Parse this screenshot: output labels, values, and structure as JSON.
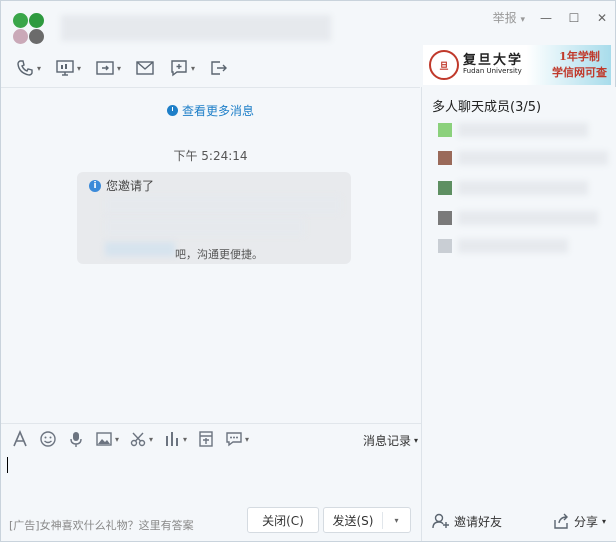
{
  "titlebar": {
    "report_label": "举报",
    "report_caret": "▾",
    "minimize": "—",
    "maximize": "☐",
    "close": "✕"
  },
  "toolbar": {
    "items": [
      {
        "name": "phone-icon"
      },
      {
        "name": "screen-share-icon"
      },
      {
        "name": "file-transfer-icon"
      },
      {
        "name": "mail-icon"
      },
      {
        "name": "add-app-icon"
      },
      {
        "name": "exit-group-icon"
      }
    ]
  },
  "banner": {
    "emblem": "旦",
    "univ_cn": "复旦大学",
    "univ_en": "Fudan University",
    "promo_line1": "1年学制",
    "promo_line2": "学信网可查"
  },
  "chat": {
    "more_messages": "查看更多消息",
    "timestamp": "下午 5:24:14",
    "notice_head": "您邀请了",
    "notice_tail": "吧，沟通更便捷。"
  },
  "input_toolbar": {
    "history_label": "消息记录",
    "caret": "▾"
  },
  "footer": {
    "ad_text": "[广告]女神喜欢什么礼物？这里有答案",
    "close_label": "关闭(C)",
    "send_label": "发送(S)",
    "send_caret": "▾"
  },
  "sidebar": {
    "members_title": "多人聊天成员(3/5)",
    "invite_label": "邀请好友",
    "share_label": "分享",
    "share_caret": "▾"
  },
  "colors": {
    "link_blue": "#1e7fc8",
    "window_bg": "#f4f7fa",
    "notice_bg": "#e8eaed"
  }
}
